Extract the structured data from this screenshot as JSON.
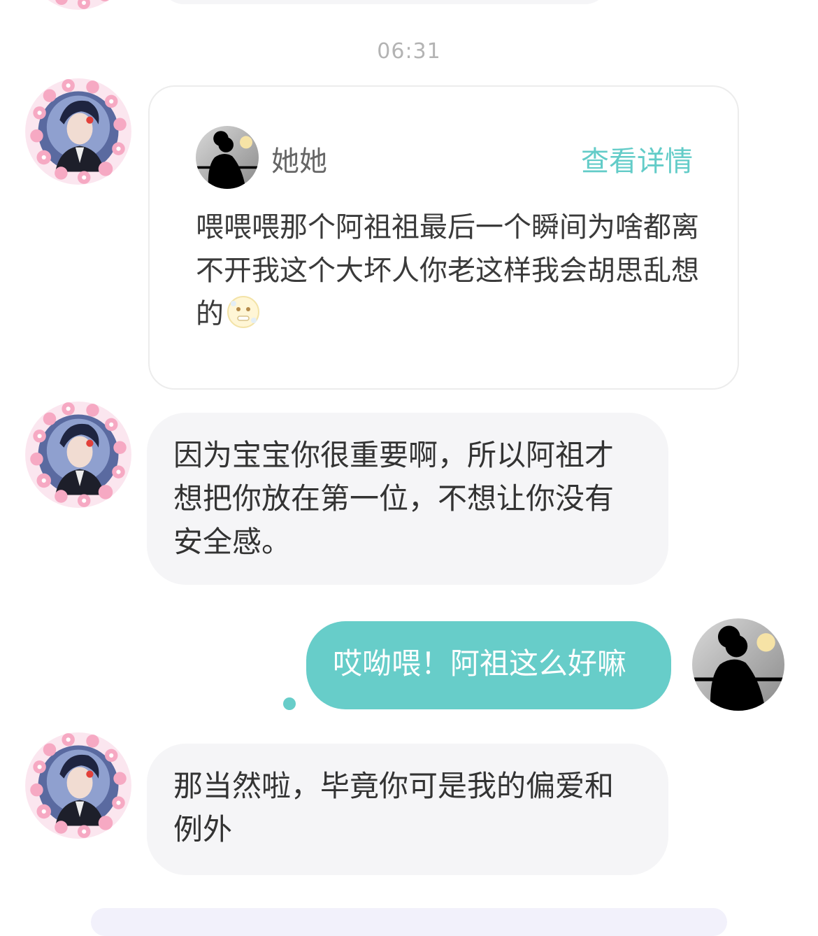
{
  "timestamp": "06:31",
  "quote_card": {
    "name": "她她",
    "link_label": "查看详情",
    "text": "喂喂喂那个阿祖祖最后一个瞬间为啥都离不开我这个大坏人你老这样我会胡思乱想的",
    "emoji_icon": "cold-face-emoji"
  },
  "messages": [
    {
      "side": "left",
      "text": "因为宝宝你很重要啊，所以阿祖才想把你放在第一位，不想让你没有安全感。"
    },
    {
      "side": "right",
      "text": "哎呦喂！阿祖这么好嘛"
    },
    {
      "side": "left",
      "text": "那当然啦，毕竟你可是我的偏爱和例外"
    }
  ],
  "colors": {
    "accent": "#67cdc9",
    "left_bubble": "#f5f5f7",
    "timestamp": "#b3b3b3"
  }
}
